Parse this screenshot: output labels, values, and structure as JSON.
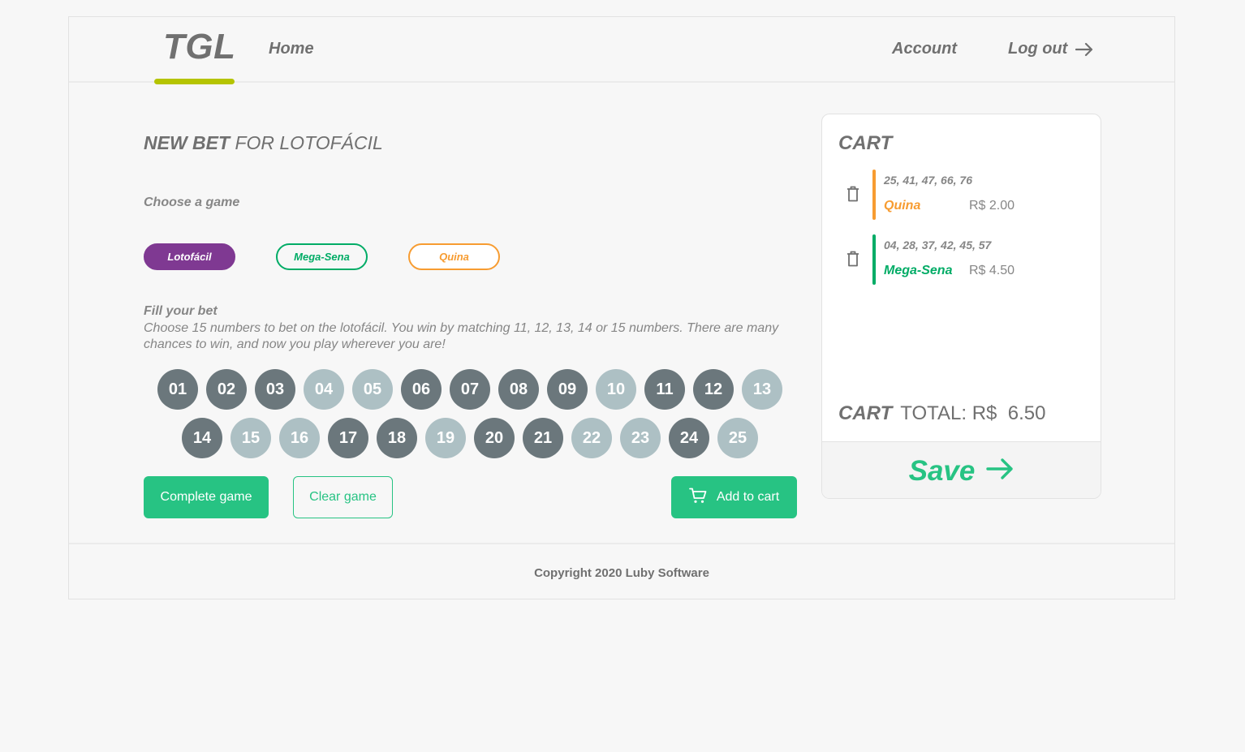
{
  "header": {
    "logo": "TGL",
    "nav": {
      "home": "Home",
      "account": "Account",
      "logout": "Log out"
    },
    "accent_color": "#b5c401"
  },
  "main": {
    "title_bold": "NEW BET",
    "title_rest": " FOR LOTOFÁCIL",
    "choose_label": "Choose a game",
    "games": [
      {
        "label": "Lotofácil",
        "color": "#7f3992",
        "active": true
      },
      {
        "label": "Mega-Sena",
        "color": "#01ac66",
        "active": false
      },
      {
        "label": "Quina",
        "color": "#f79c31",
        "active": false
      }
    ],
    "fill_label": "Fill your bet",
    "fill_description": "Choose 15 numbers to bet on the lotofácil. You win by matching 11, 12, 13, 14 or 15 numbers. There are many chances to win, and now you play wherever you are!",
    "numbers": [
      {
        "label": "01",
        "selected": true
      },
      {
        "label": "02",
        "selected": true
      },
      {
        "label": "03",
        "selected": true
      },
      {
        "label": "04",
        "selected": false
      },
      {
        "label": "05",
        "selected": false
      },
      {
        "label": "06",
        "selected": true
      },
      {
        "label": "07",
        "selected": true
      },
      {
        "label": "08",
        "selected": true
      },
      {
        "label": "09",
        "selected": true
      },
      {
        "label": "10",
        "selected": false
      },
      {
        "label": "11",
        "selected": true
      },
      {
        "label": "12",
        "selected": true
      },
      {
        "label": "13",
        "selected": false
      },
      {
        "label": "14",
        "selected": true
      },
      {
        "label": "15",
        "selected": false
      },
      {
        "label": "16",
        "selected": false
      },
      {
        "label": "17",
        "selected": true
      },
      {
        "label": "18",
        "selected": true
      },
      {
        "label": "19",
        "selected": false
      },
      {
        "label": "20",
        "selected": true
      },
      {
        "label": "21",
        "selected": true
      },
      {
        "label": "22",
        "selected": false
      },
      {
        "label": "23",
        "selected": false
      },
      {
        "label": "24",
        "selected": true
      },
      {
        "label": "25",
        "selected": false
      }
    ],
    "buttons": {
      "complete": "Complete game",
      "clear": "Clear game",
      "add_to_cart": "Add to cart"
    }
  },
  "cart": {
    "title": "CART",
    "items": [
      {
        "numbers": "25, 41, 47, 66, 76",
        "game": "Quina",
        "price": "R$ 2.00",
        "color": "#f79c31"
      },
      {
        "numbers": "04, 28, 37, 42, 45, 57",
        "game": "Mega-Sena",
        "price": "R$ 4.50",
        "color": "#01ac66"
      }
    ],
    "total_label": "CART",
    "total_value": "TOTAL: R$  6.50",
    "save": "Save"
  },
  "footer": {
    "copyright": "Copyright 2020 Luby Software"
  },
  "colors": {
    "primary": "#27c383",
    "selected_number": "#6b777c",
    "unselected_number": "#adc0c4"
  }
}
